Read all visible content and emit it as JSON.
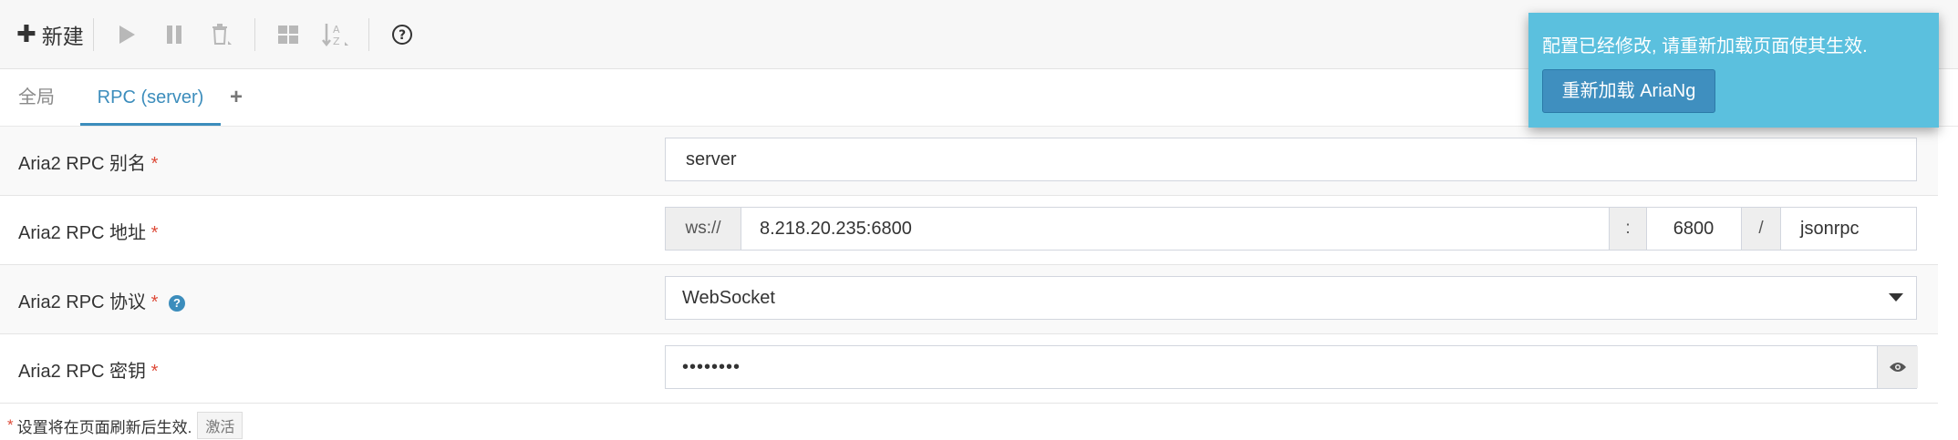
{
  "toolbar": {
    "new_label": "新建",
    "icons": [
      "plus-icon",
      "play-icon",
      "pause-icon",
      "trash-icon",
      "grid-icon",
      "sort-az-icon",
      "help-icon"
    ]
  },
  "tabs": {
    "global": "全局",
    "rpc": "RPC (server)",
    "add": "+"
  },
  "settings": {
    "alias": {
      "label": "Aria2 RPC 别名",
      "required": "*",
      "value": "server"
    },
    "address": {
      "label": "Aria2 RPC 地址",
      "required": "*",
      "protocol": "ws://",
      "host": "8.218.20.235:6800",
      "colon": ":",
      "port": "6800",
      "slash": "/",
      "path": "jsonrpc"
    },
    "protocol": {
      "label": "Aria2 RPC 协议",
      "required": "*",
      "value": "WebSocket"
    },
    "secret": {
      "label": "Aria2 RPC 密钥",
      "required": "*",
      "value": "••••••••"
    }
  },
  "footnote": {
    "star": "*",
    "text": "设置将在页面刷新后生效.",
    "button": "激活"
  },
  "toast": {
    "message": "配置已经修改, 请重新加载页面使其生效.",
    "button": "重新加载 AriaNg"
  },
  "colors": {
    "accent": "#3c8dbc",
    "required": "#dd4b39",
    "toast_bg": "#5bc0de"
  }
}
